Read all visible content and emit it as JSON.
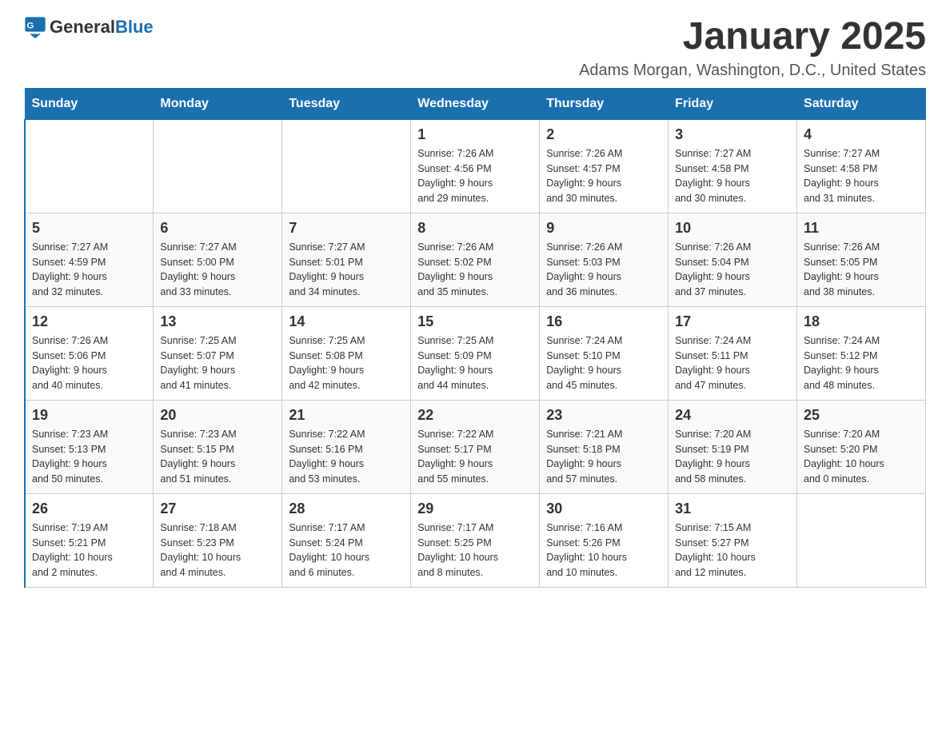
{
  "logo": {
    "text_general": "General",
    "text_blue": "Blue"
  },
  "header": {
    "title": "January 2025",
    "location": "Adams Morgan, Washington, D.C., United States"
  },
  "weekdays": [
    "Sunday",
    "Monday",
    "Tuesday",
    "Wednesday",
    "Thursday",
    "Friday",
    "Saturday"
  ],
  "weeks": [
    [
      {
        "day": "",
        "info": ""
      },
      {
        "day": "",
        "info": ""
      },
      {
        "day": "",
        "info": ""
      },
      {
        "day": "1",
        "info": "Sunrise: 7:26 AM\nSunset: 4:56 PM\nDaylight: 9 hours\nand 29 minutes."
      },
      {
        "day": "2",
        "info": "Sunrise: 7:26 AM\nSunset: 4:57 PM\nDaylight: 9 hours\nand 30 minutes."
      },
      {
        "day": "3",
        "info": "Sunrise: 7:27 AM\nSunset: 4:58 PM\nDaylight: 9 hours\nand 30 minutes."
      },
      {
        "day": "4",
        "info": "Sunrise: 7:27 AM\nSunset: 4:58 PM\nDaylight: 9 hours\nand 31 minutes."
      }
    ],
    [
      {
        "day": "5",
        "info": "Sunrise: 7:27 AM\nSunset: 4:59 PM\nDaylight: 9 hours\nand 32 minutes."
      },
      {
        "day": "6",
        "info": "Sunrise: 7:27 AM\nSunset: 5:00 PM\nDaylight: 9 hours\nand 33 minutes."
      },
      {
        "day": "7",
        "info": "Sunrise: 7:27 AM\nSunset: 5:01 PM\nDaylight: 9 hours\nand 34 minutes."
      },
      {
        "day": "8",
        "info": "Sunrise: 7:26 AM\nSunset: 5:02 PM\nDaylight: 9 hours\nand 35 minutes."
      },
      {
        "day": "9",
        "info": "Sunrise: 7:26 AM\nSunset: 5:03 PM\nDaylight: 9 hours\nand 36 minutes."
      },
      {
        "day": "10",
        "info": "Sunrise: 7:26 AM\nSunset: 5:04 PM\nDaylight: 9 hours\nand 37 minutes."
      },
      {
        "day": "11",
        "info": "Sunrise: 7:26 AM\nSunset: 5:05 PM\nDaylight: 9 hours\nand 38 minutes."
      }
    ],
    [
      {
        "day": "12",
        "info": "Sunrise: 7:26 AM\nSunset: 5:06 PM\nDaylight: 9 hours\nand 40 minutes."
      },
      {
        "day": "13",
        "info": "Sunrise: 7:25 AM\nSunset: 5:07 PM\nDaylight: 9 hours\nand 41 minutes."
      },
      {
        "day": "14",
        "info": "Sunrise: 7:25 AM\nSunset: 5:08 PM\nDaylight: 9 hours\nand 42 minutes."
      },
      {
        "day": "15",
        "info": "Sunrise: 7:25 AM\nSunset: 5:09 PM\nDaylight: 9 hours\nand 44 minutes."
      },
      {
        "day": "16",
        "info": "Sunrise: 7:24 AM\nSunset: 5:10 PM\nDaylight: 9 hours\nand 45 minutes."
      },
      {
        "day": "17",
        "info": "Sunrise: 7:24 AM\nSunset: 5:11 PM\nDaylight: 9 hours\nand 47 minutes."
      },
      {
        "day": "18",
        "info": "Sunrise: 7:24 AM\nSunset: 5:12 PM\nDaylight: 9 hours\nand 48 minutes."
      }
    ],
    [
      {
        "day": "19",
        "info": "Sunrise: 7:23 AM\nSunset: 5:13 PM\nDaylight: 9 hours\nand 50 minutes."
      },
      {
        "day": "20",
        "info": "Sunrise: 7:23 AM\nSunset: 5:15 PM\nDaylight: 9 hours\nand 51 minutes."
      },
      {
        "day": "21",
        "info": "Sunrise: 7:22 AM\nSunset: 5:16 PM\nDaylight: 9 hours\nand 53 minutes."
      },
      {
        "day": "22",
        "info": "Sunrise: 7:22 AM\nSunset: 5:17 PM\nDaylight: 9 hours\nand 55 minutes."
      },
      {
        "day": "23",
        "info": "Sunrise: 7:21 AM\nSunset: 5:18 PM\nDaylight: 9 hours\nand 57 minutes."
      },
      {
        "day": "24",
        "info": "Sunrise: 7:20 AM\nSunset: 5:19 PM\nDaylight: 9 hours\nand 58 minutes."
      },
      {
        "day": "25",
        "info": "Sunrise: 7:20 AM\nSunset: 5:20 PM\nDaylight: 10 hours\nand 0 minutes."
      }
    ],
    [
      {
        "day": "26",
        "info": "Sunrise: 7:19 AM\nSunset: 5:21 PM\nDaylight: 10 hours\nand 2 minutes."
      },
      {
        "day": "27",
        "info": "Sunrise: 7:18 AM\nSunset: 5:23 PM\nDaylight: 10 hours\nand 4 minutes."
      },
      {
        "day": "28",
        "info": "Sunrise: 7:17 AM\nSunset: 5:24 PM\nDaylight: 10 hours\nand 6 minutes."
      },
      {
        "day": "29",
        "info": "Sunrise: 7:17 AM\nSunset: 5:25 PM\nDaylight: 10 hours\nand 8 minutes."
      },
      {
        "day": "30",
        "info": "Sunrise: 7:16 AM\nSunset: 5:26 PM\nDaylight: 10 hours\nand 10 minutes."
      },
      {
        "day": "31",
        "info": "Sunrise: 7:15 AM\nSunset: 5:27 PM\nDaylight: 10 hours\nand 12 minutes."
      },
      {
        "day": "",
        "info": ""
      }
    ]
  ]
}
